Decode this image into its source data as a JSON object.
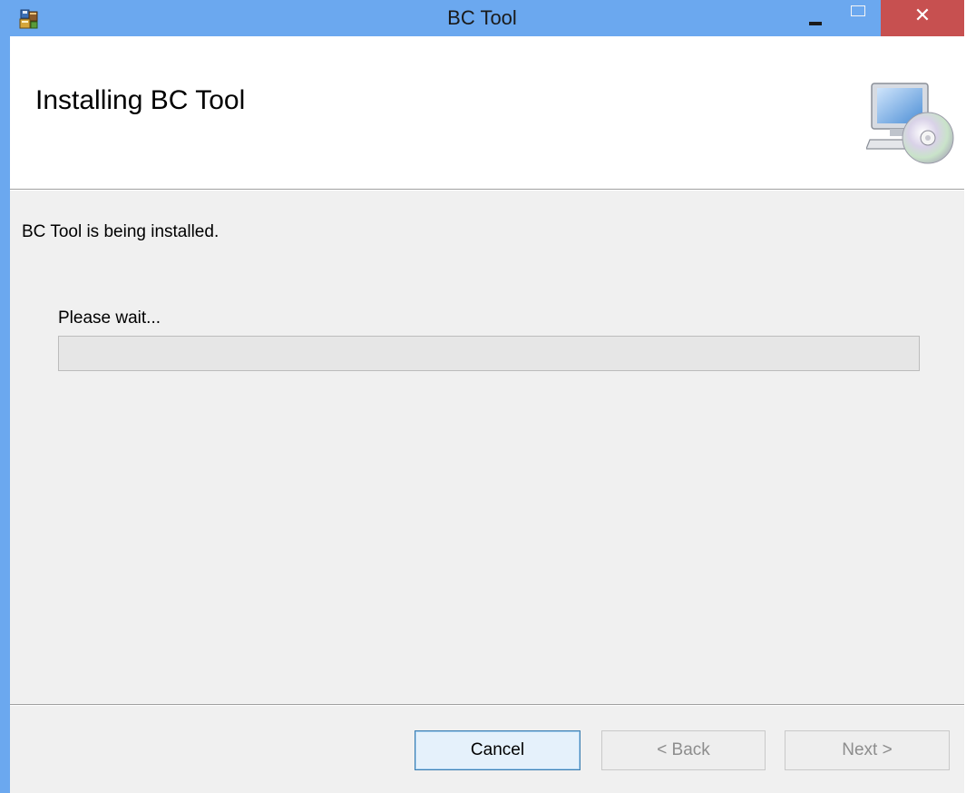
{
  "window": {
    "title": "BC Tool",
    "title_bar_color": "#6ba8ef",
    "close_button_color": "#c75050",
    "controls": {
      "minimize_icon": "minimize-icon",
      "maximize_icon": "maximize-icon",
      "close_label": "✕"
    }
  },
  "banner": {
    "title": "Installing BC Tool",
    "icon": "computer-disc-icon"
  },
  "body": {
    "status_text": "BC Tool is being installed.",
    "wait_label": "Please wait...",
    "progress_fraction": 0
  },
  "footer": {
    "cancel_label": "Cancel",
    "back_label": "< Back",
    "next_label": "Next >",
    "back_enabled": false,
    "next_enabled": false
  }
}
